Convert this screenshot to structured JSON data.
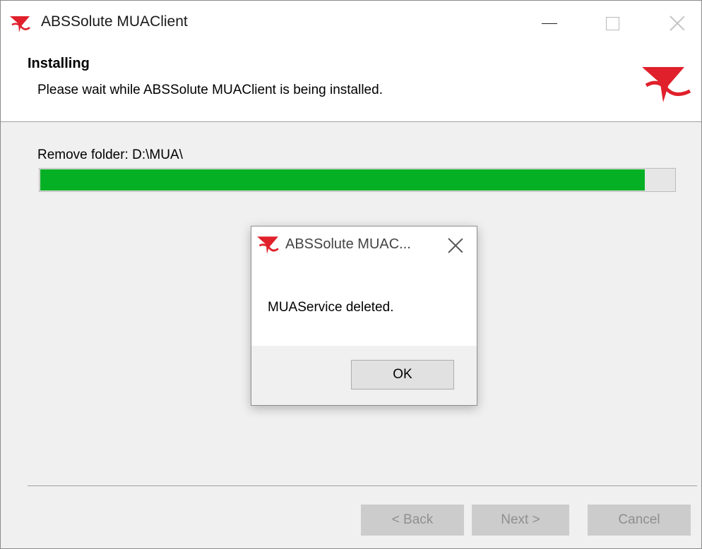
{
  "window": {
    "title": "ABSSolute MUAClient",
    "icon": "absolute-logo-icon",
    "controls": {
      "minimize": "minimize-icon",
      "maximize": "maximize-icon",
      "close": "close-icon"
    }
  },
  "header": {
    "heading": "Installing",
    "subheading": "Please wait while ABSSolute MUAClient is being installed.",
    "logo": "absolute-logo-icon"
  },
  "progress": {
    "status_text": "Remove folder: D:\\MUA\\",
    "fraction": 0.953,
    "color": "#06b025"
  },
  "footer": {
    "back_label": "< Back",
    "next_label": "Next >",
    "cancel_label": "Cancel"
  },
  "dialog": {
    "title": "ABSSolute MUAC...",
    "message": "MUAService deleted.",
    "ok_label": "OK"
  },
  "colors": {
    "brand_red": "#e0202b",
    "disabled_text": "#8f8f8f"
  }
}
